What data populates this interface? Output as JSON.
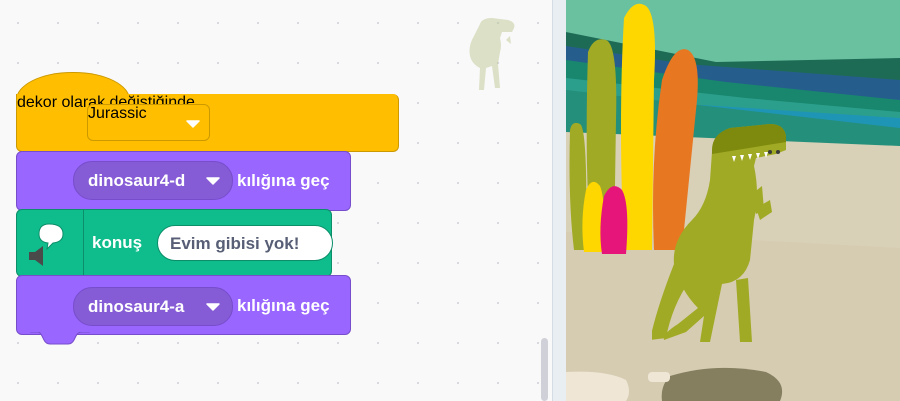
{
  "colors": {
    "events": "#ffbf00",
    "looks": "#9966ff",
    "looks_pill": "#855cd6",
    "pen_extension": "#0fbd8c",
    "stage_sky": "#6ac19f",
    "dino": "#a1aa24"
  },
  "blocks": {
    "hat": {
      "prefix": "dekor",
      "dropdown_value": "Jurassic",
      "suffix": "olarak değiştiğinde"
    },
    "switch_costume_1": {
      "dropdown_value": "dinosaur4-d",
      "suffix": "kılığına geç"
    },
    "speak": {
      "icon": "speech-bubble-icon",
      "label": "konuş",
      "input_value": "Evim gibisi yok!"
    },
    "switch_costume_2": {
      "dropdown_value": "dinosaur4-a",
      "suffix": "kılığına geç"
    }
  },
  "icons": {
    "dropdown": "chevron-down-icon",
    "sprite_thumbnail": "dinosaur-sprite-icon"
  }
}
